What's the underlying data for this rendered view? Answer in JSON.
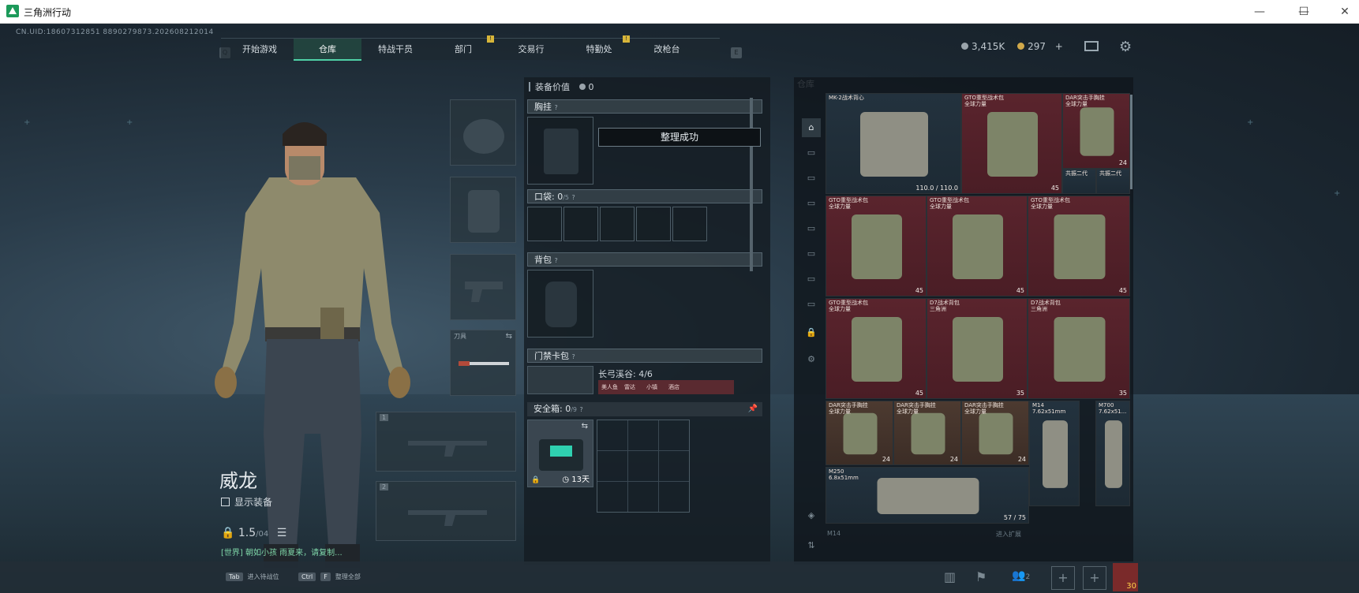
{
  "window": {
    "title": "三角洲行动",
    "minimize": "—",
    "maximize": "☐",
    "close": "✕"
  },
  "uid": "CN.UID:18607312851 8890279873.202608212014",
  "nav": {
    "left_key": "Q",
    "right_key": "E",
    "tabs": [
      {
        "label": "开始游戏",
        "active": false,
        "badge": ""
      },
      {
        "label": "仓库",
        "active": true,
        "badge": ""
      },
      {
        "label": "特战干员",
        "active": false,
        "badge": ""
      },
      {
        "label": "部门",
        "active": false,
        "badge": "!"
      },
      {
        "label": "交易行",
        "active": false,
        "badge": ""
      },
      {
        "label": "特勤处",
        "active": false,
        "badge": "!"
      },
      {
        "label": "改枪台",
        "active": false,
        "badge": ""
      }
    ]
  },
  "currency": {
    "silver": "3,415K",
    "gold": "297",
    "plus": "+"
  },
  "character": {
    "name": "威龙",
    "show_equipment": "显示装备",
    "level": "1.5",
    "level_sub": "/04",
    "chat": "[世界] 朝如小孩 雨夏来，请复制...",
    "chat_icon": "list-icon"
  },
  "equipment_slots": {
    "melee_label": "刀具",
    "weapon1_num": "1",
    "weapon2_num": "2"
  },
  "middle": {
    "value_label": "装备价值",
    "value": "0",
    "toast": "整理成功",
    "chest_rig": "胸挂",
    "pocket": "口袋:",
    "pocket_count": "0",
    "pocket_max": "/5",
    "backpack": "背包",
    "keycard": "门禁卡包",
    "keycard_item": "长弓溪谷: 4/6",
    "keycard_tags": [
      "美人鱼",
      "雷达",
      "小镇",
      "酒店"
    ],
    "safebox": "安全箱:",
    "safebox_count": "0",
    "safebox_max": "/9",
    "safebox_timer": "13天",
    "help": "?"
  },
  "warehouse": {
    "title": "仓库",
    "items": [
      {
        "name": "MK-2战术背心",
        "sub": "",
        "qty": "110.0 / 110.0",
        "bg": "blue"
      },
      {
        "name": "GTO重型战术包",
        "sub": "全球力量",
        "qty": "45",
        "bg": "red"
      },
      {
        "name": "DAR突击手胸挂",
        "sub": "全球力量",
        "qty": "24",
        "bg": "red"
      },
      {
        "name": "GTO重型战术包",
        "sub": "全球力量",
        "qty": "45",
        "bg": "red"
      },
      {
        "name": "GTO重型战术包",
        "sub": "全球力量",
        "qty": "45",
        "bg": "red"
      },
      {
        "name": "GTO重型战术包",
        "sub": "全球力量",
        "qty": "45",
        "bg": "red"
      },
      {
        "name": "GTO重型战术包",
        "sub": "全球力量",
        "qty": "45",
        "bg": "red"
      },
      {
        "name": "D7战术背包",
        "sub": "三角洲",
        "qty": "35",
        "bg": "red"
      },
      {
        "name": "D7战术背包",
        "sub": "三角洲",
        "qty": "35",
        "bg": "red"
      },
      {
        "name": "DAR突击手胸挂",
        "sub": "全球力量",
        "qty": "24",
        "bg": "brown"
      },
      {
        "name": "DAR突击手胸挂",
        "sub": "全球力量",
        "qty": "24",
        "bg": "brown"
      },
      {
        "name": "DAR突击手胸挂",
        "sub": "全球力量",
        "qty": "24",
        "bg": "brown"
      },
      {
        "name": "M14",
        "sub": "7.62x51mm",
        "qty": "",
        "bg": "blue"
      },
      {
        "name": "M700",
        "sub": "7.62x51...",
        "qty": "",
        "bg": "blue"
      },
      {
        "name": "M250",
        "sub": "6.8x51mm",
        "qty": "57 / 75",
        "bg": "blue"
      }
    ],
    "sub_items": [
      {
        "name": "共振二代"
      },
      {
        "name": "共振二代"
      }
    ],
    "footer_left": "M14",
    "footer_mid": "进入扩展"
  },
  "bottom": {
    "hint1_key": "Tab",
    "hint1": "进入待战位",
    "hint2_key": "Ctrl",
    "hint2_key2": "F",
    "hint2": "整理全部",
    "team_count": "2",
    "avatar_level": "30"
  }
}
